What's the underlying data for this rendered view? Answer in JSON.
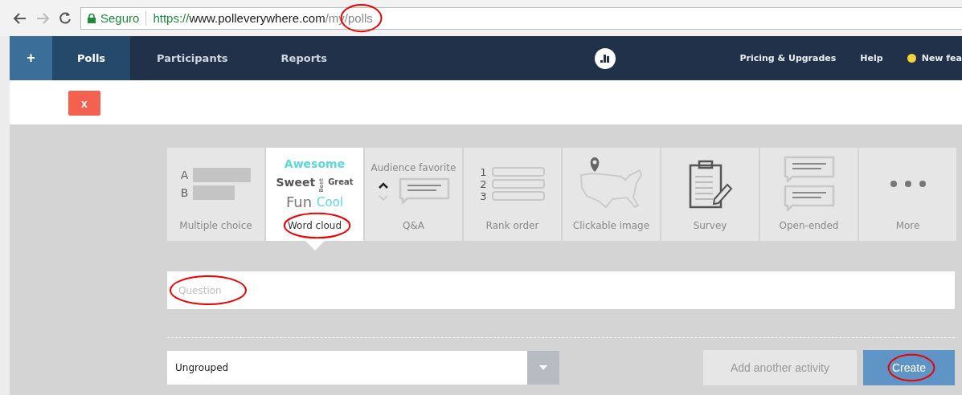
{
  "browser": {
    "secure_label": "Seguro",
    "url_scheme": "https://",
    "url_host": "www.polleverywhere.com",
    "url_path": "/my",
    "url_last": "/polls",
    "url_last_circled": true
  },
  "nav": {
    "plus": "+",
    "tabs": [
      {
        "label": "Polls",
        "selected": true
      },
      {
        "label": "Participants",
        "selected": false
      },
      {
        "label": "Reports",
        "selected": false
      }
    ],
    "right": [
      {
        "label": "Pricing & Upgrades",
        "kind": "link"
      },
      {
        "label": "Help",
        "kind": "link"
      },
      {
        "label": "New fea",
        "kind": "dot-link",
        "color": "#f5d33c"
      }
    ]
  },
  "close_button": "x",
  "tiles": [
    {
      "kind": "multiple-choice",
      "label": "Multiple choice",
      "selected": false,
      "letters": [
        "A",
        "B"
      ]
    },
    {
      "kind": "word-cloud",
      "label": "Word cloud",
      "selected": true,
      "circled": true,
      "words": [
        "Awesome",
        "Sweet",
        "Best",
        "Great",
        "Fun",
        "Cool"
      ]
    },
    {
      "kind": "qa",
      "label": "Q&A",
      "selected": false,
      "badge": "Audience favorite"
    },
    {
      "kind": "rank",
      "label": "Rank order",
      "selected": false,
      "numbers": [
        "1",
        "2",
        "3"
      ]
    },
    {
      "kind": "map",
      "label": "Clickable image",
      "selected": false
    },
    {
      "kind": "survey",
      "label": "Survey",
      "selected": false
    },
    {
      "kind": "open",
      "label": "Open-ended",
      "selected": false
    },
    {
      "kind": "more",
      "label": "More",
      "selected": false
    }
  ],
  "question": {
    "placeholder": "Question",
    "circled": true
  },
  "group_select": {
    "value": "Ungrouped"
  },
  "buttons": [
    {
      "label": "Add another activity",
      "kind": "secondary",
      "circled": false
    },
    {
      "label": "Create",
      "kind": "primary",
      "circled": true
    }
  ]
}
